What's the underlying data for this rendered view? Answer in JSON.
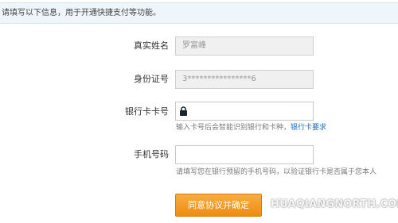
{
  "notice": {
    "text": "请填写以下信息，用于开通快捷支付等功能。"
  },
  "form": {
    "name": {
      "label": "真实姓名",
      "value": "罗富峰"
    },
    "id_number": {
      "label": "身份证号",
      "value": "3****************6"
    },
    "bank_card": {
      "label": "银行卡卡号",
      "value": "",
      "hint": "输入卡号后会智能识别银行和卡种，",
      "hint_link": "银行卡要求",
      "icon": "lock-icon"
    },
    "phone": {
      "label": "手机号码",
      "value": "",
      "hint": "请填写您在银行预留的手机号码，以验证银行卡是否属于您本人"
    },
    "submit": {
      "label": "同意协议并确定"
    }
  },
  "watermark": {
    "text": "HUAQIANGNORTH.COM"
  },
  "colors": {
    "notice_background": "#eef6fb",
    "button_orange": "#f29a21",
    "link_blue": "#1f6fb8"
  }
}
